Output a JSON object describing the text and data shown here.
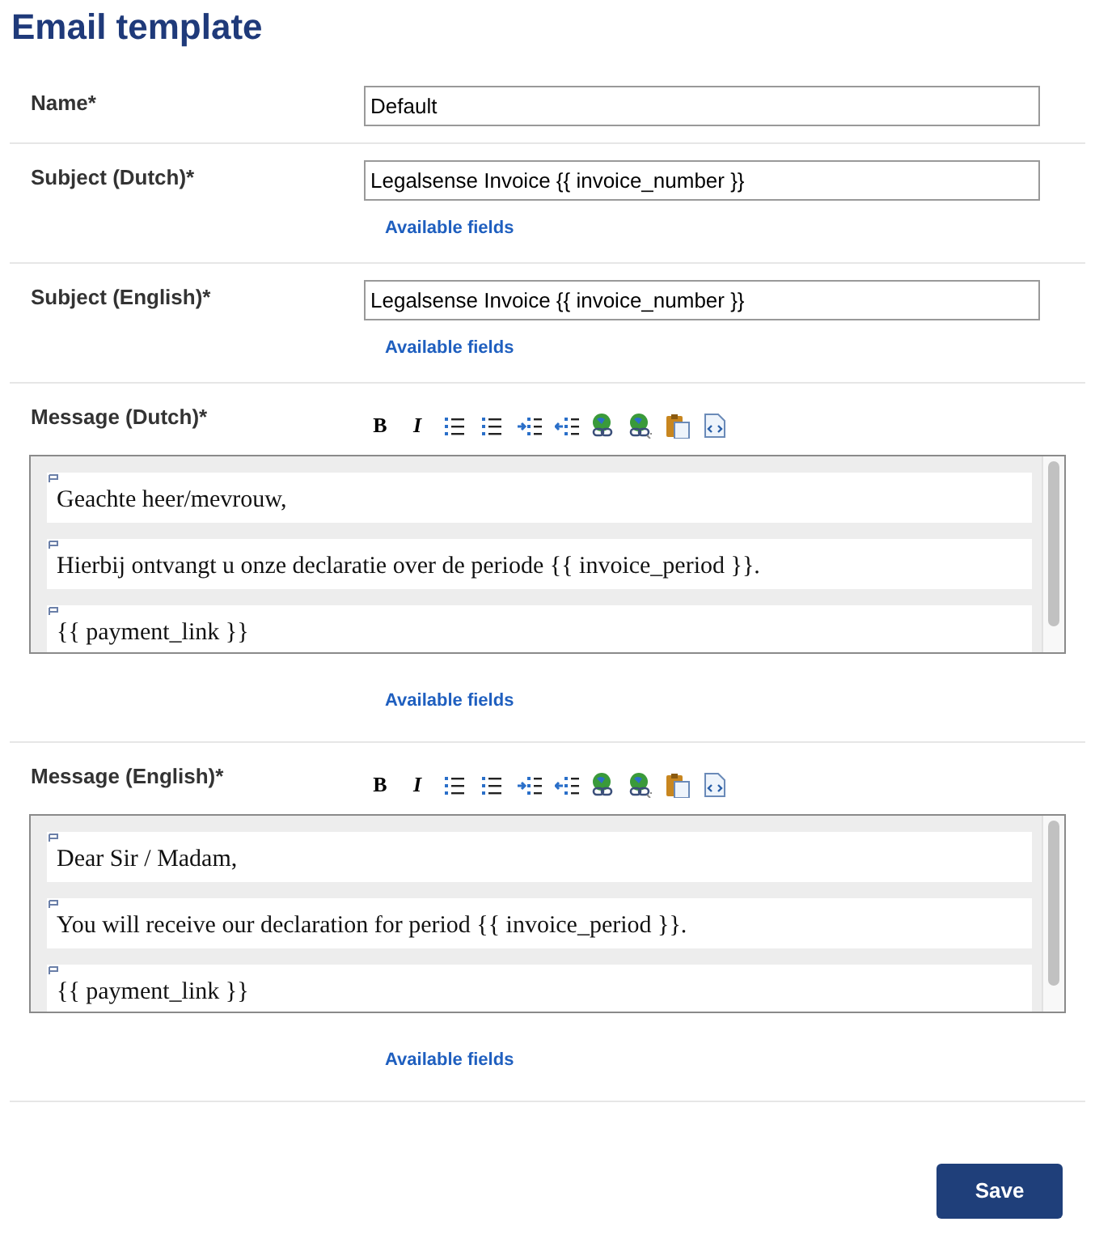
{
  "title": "Email template",
  "fields": [
    {
      "kind": "text",
      "label": "Name*",
      "value": "Default"
    },
    {
      "kind": "text",
      "label": "Subject (Dutch)*",
      "value": "Legalsense Invoice {{ invoice_number }}",
      "link": "Available fields"
    },
    {
      "kind": "text",
      "label": "Subject (English)*",
      "value": "Legalsense Invoice {{ invoice_number }}",
      "link": "Available fields"
    },
    {
      "kind": "editor",
      "label": "Message (Dutch)*",
      "toolbar": [
        {
          "kind": "bold",
          "label": "B"
        },
        {
          "kind": "italic",
          "label": "I"
        },
        {
          "kind": "ordered-list"
        },
        {
          "kind": "bullet-list"
        },
        {
          "kind": "indent"
        },
        {
          "kind": "outdent"
        },
        {
          "kind": "link"
        },
        {
          "kind": "unlink"
        },
        {
          "kind": "paste"
        },
        {
          "kind": "source"
        }
      ],
      "paragraphs": [
        "Geachte heer/mevrouw,",
        "Hierbij ontvangt u onze declaratie over de periode {{ invoice_period }}.",
        "{{ payment_link }}"
      ],
      "link": "Available fields"
    },
    {
      "kind": "editor",
      "label": "Message (English)*",
      "toolbar": [
        {
          "kind": "bold",
          "label": "B"
        },
        {
          "kind": "italic",
          "label": "I"
        },
        {
          "kind": "ordered-list"
        },
        {
          "kind": "bullet-list"
        },
        {
          "kind": "indent"
        },
        {
          "kind": "outdent"
        },
        {
          "kind": "link"
        },
        {
          "kind": "unlink"
        },
        {
          "kind": "paste"
        },
        {
          "kind": "source"
        }
      ],
      "paragraphs": [
        "Dear Sir / Madam,",
        "You will receive our declaration for period {{ invoice_period }}.",
        "{{ payment_link }}"
      ],
      "link": "Available fields"
    }
  ],
  "save": "Save"
}
